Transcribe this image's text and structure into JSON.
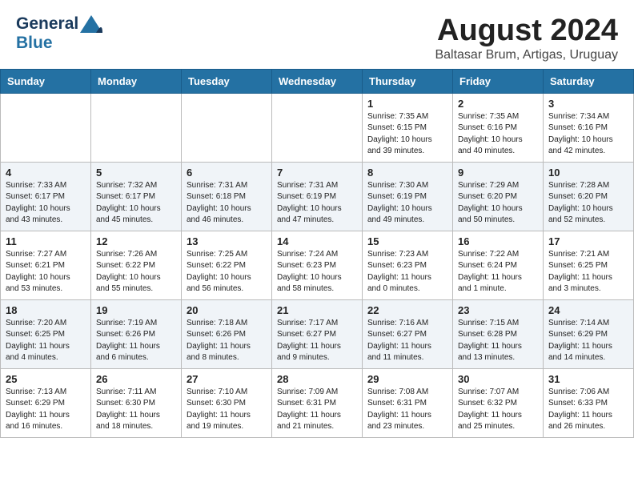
{
  "header": {
    "logo_general": "General",
    "logo_blue": "Blue",
    "month_title": "August 2024",
    "location": "Baltasar Brum, Artigas, Uruguay"
  },
  "days_of_week": [
    "Sunday",
    "Monday",
    "Tuesday",
    "Wednesday",
    "Thursday",
    "Friday",
    "Saturday"
  ],
  "weeks": [
    [
      {
        "day": "",
        "info": ""
      },
      {
        "day": "",
        "info": ""
      },
      {
        "day": "",
        "info": ""
      },
      {
        "day": "",
        "info": ""
      },
      {
        "day": "1",
        "info": "Sunrise: 7:35 AM\nSunset: 6:15 PM\nDaylight: 10 hours\nand 39 minutes."
      },
      {
        "day": "2",
        "info": "Sunrise: 7:35 AM\nSunset: 6:16 PM\nDaylight: 10 hours\nand 40 minutes."
      },
      {
        "day": "3",
        "info": "Sunrise: 7:34 AM\nSunset: 6:16 PM\nDaylight: 10 hours\nand 42 minutes."
      }
    ],
    [
      {
        "day": "4",
        "info": "Sunrise: 7:33 AM\nSunset: 6:17 PM\nDaylight: 10 hours\nand 43 minutes."
      },
      {
        "day": "5",
        "info": "Sunrise: 7:32 AM\nSunset: 6:17 PM\nDaylight: 10 hours\nand 45 minutes."
      },
      {
        "day": "6",
        "info": "Sunrise: 7:31 AM\nSunset: 6:18 PM\nDaylight: 10 hours\nand 46 minutes."
      },
      {
        "day": "7",
        "info": "Sunrise: 7:31 AM\nSunset: 6:19 PM\nDaylight: 10 hours\nand 47 minutes."
      },
      {
        "day": "8",
        "info": "Sunrise: 7:30 AM\nSunset: 6:19 PM\nDaylight: 10 hours\nand 49 minutes."
      },
      {
        "day": "9",
        "info": "Sunrise: 7:29 AM\nSunset: 6:20 PM\nDaylight: 10 hours\nand 50 minutes."
      },
      {
        "day": "10",
        "info": "Sunrise: 7:28 AM\nSunset: 6:20 PM\nDaylight: 10 hours\nand 52 minutes."
      }
    ],
    [
      {
        "day": "11",
        "info": "Sunrise: 7:27 AM\nSunset: 6:21 PM\nDaylight: 10 hours\nand 53 minutes."
      },
      {
        "day": "12",
        "info": "Sunrise: 7:26 AM\nSunset: 6:22 PM\nDaylight: 10 hours\nand 55 minutes."
      },
      {
        "day": "13",
        "info": "Sunrise: 7:25 AM\nSunset: 6:22 PM\nDaylight: 10 hours\nand 56 minutes."
      },
      {
        "day": "14",
        "info": "Sunrise: 7:24 AM\nSunset: 6:23 PM\nDaylight: 10 hours\nand 58 minutes."
      },
      {
        "day": "15",
        "info": "Sunrise: 7:23 AM\nSunset: 6:23 PM\nDaylight: 11 hours\nand 0 minutes."
      },
      {
        "day": "16",
        "info": "Sunrise: 7:22 AM\nSunset: 6:24 PM\nDaylight: 11 hours\nand 1 minute."
      },
      {
        "day": "17",
        "info": "Sunrise: 7:21 AM\nSunset: 6:25 PM\nDaylight: 11 hours\nand 3 minutes."
      }
    ],
    [
      {
        "day": "18",
        "info": "Sunrise: 7:20 AM\nSunset: 6:25 PM\nDaylight: 11 hours\nand 4 minutes."
      },
      {
        "day": "19",
        "info": "Sunrise: 7:19 AM\nSunset: 6:26 PM\nDaylight: 11 hours\nand 6 minutes."
      },
      {
        "day": "20",
        "info": "Sunrise: 7:18 AM\nSunset: 6:26 PM\nDaylight: 11 hours\nand 8 minutes."
      },
      {
        "day": "21",
        "info": "Sunrise: 7:17 AM\nSunset: 6:27 PM\nDaylight: 11 hours\nand 9 minutes."
      },
      {
        "day": "22",
        "info": "Sunrise: 7:16 AM\nSunset: 6:27 PM\nDaylight: 11 hours\nand 11 minutes."
      },
      {
        "day": "23",
        "info": "Sunrise: 7:15 AM\nSunset: 6:28 PM\nDaylight: 11 hours\nand 13 minutes."
      },
      {
        "day": "24",
        "info": "Sunrise: 7:14 AM\nSunset: 6:29 PM\nDaylight: 11 hours\nand 14 minutes."
      }
    ],
    [
      {
        "day": "25",
        "info": "Sunrise: 7:13 AM\nSunset: 6:29 PM\nDaylight: 11 hours\nand 16 minutes."
      },
      {
        "day": "26",
        "info": "Sunrise: 7:11 AM\nSunset: 6:30 PM\nDaylight: 11 hours\nand 18 minutes."
      },
      {
        "day": "27",
        "info": "Sunrise: 7:10 AM\nSunset: 6:30 PM\nDaylight: 11 hours\nand 19 minutes."
      },
      {
        "day": "28",
        "info": "Sunrise: 7:09 AM\nSunset: 6:31 PM\nDaylight: 11 hours\nand 21 minutes."
      },
      {
        "day": "29",
        "info": "Sunrise: 7:08 AM\nSunset: 6:31 PM\nDaylight: 11 hours\nand 23 minutes."
      },
      {
        "day": "30",
        "info": "Sunrise: 7:07 AM\nSunset: 6:32 PM\nDaylight: 11 hours\nand 25 minutes."
      },
      {
        "day": "31",
        "info": "Sunrise: 7:06 AM\nSunset: 6:33 PM\nDaylight: 11 hours\nand 26 minutes."
      }
    ]
  ]
}
